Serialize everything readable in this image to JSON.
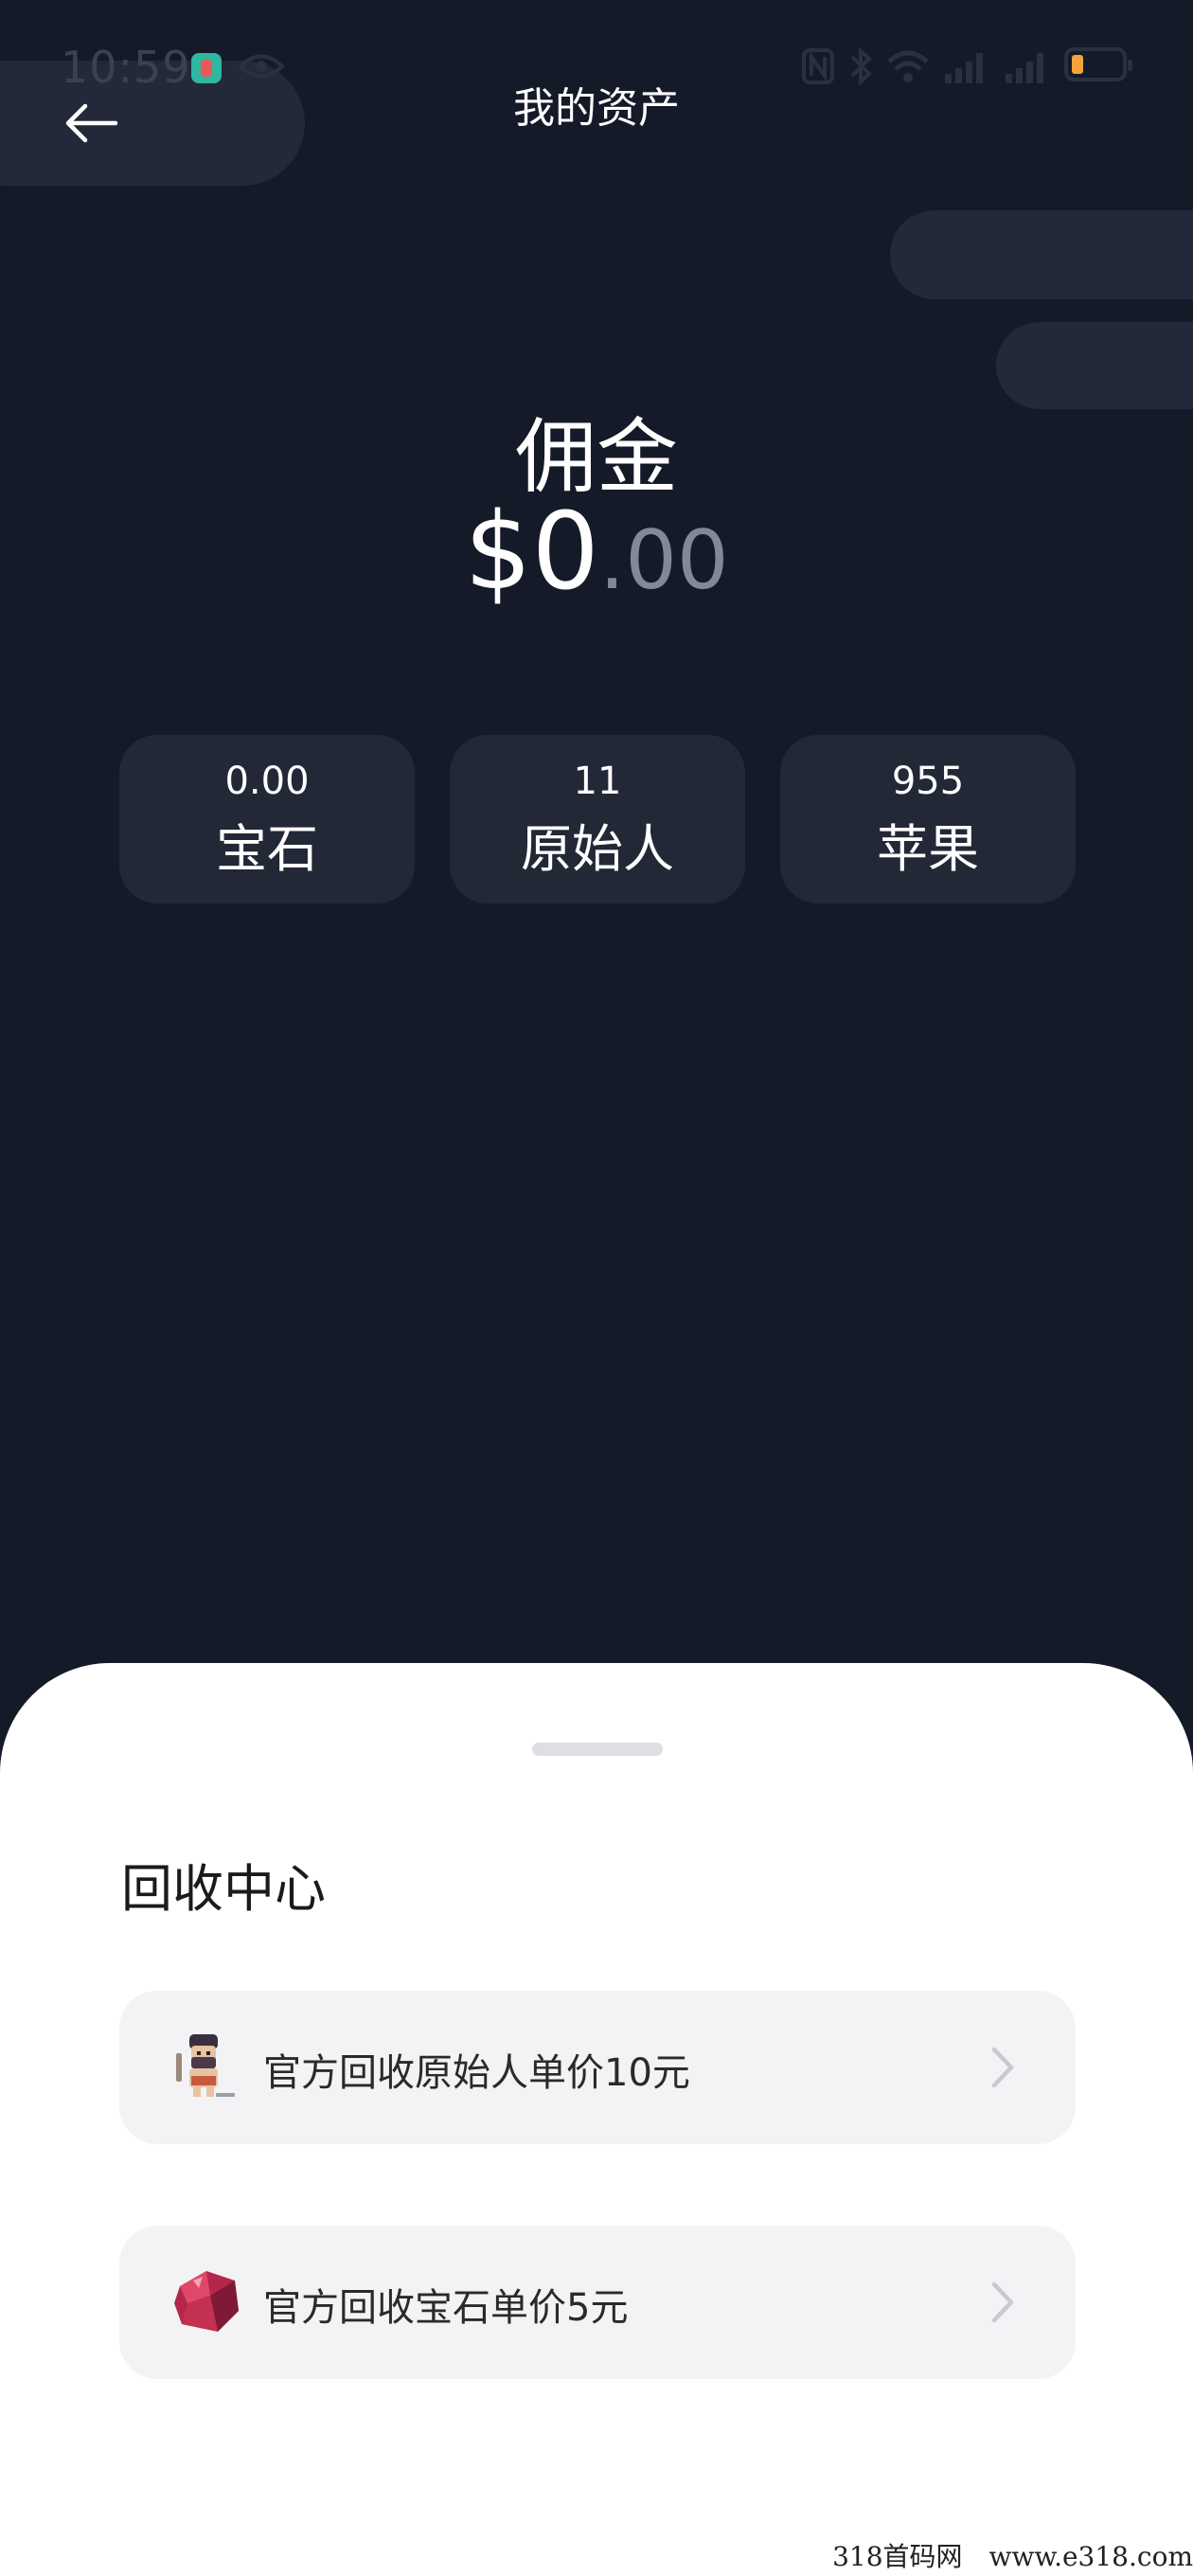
{
  "status_bar": {
    "time": "10:59"
  },
  "header": {
    "title": "我的资产",
    "back_icon": "arrow-left-icon"
  },
  "balance": {
    "label": "佣金",
    "currency": "$",
    "integer": "0",
    "decimal": ".00"
  },
  "stats": [
    {
      "value": "0.00",
      "label": "宝石"
    },
    {
      "value": "11",
      "label": "原始人"
    },
    {
      "value": "955",
      "label": "苹果"
    }
  ],
  "recycle": {
    "title": "回收中心",
    "items": [
      {
        "text": "官方回收原始人单价10元",
        "icon": "caveman-icon"
      },
      {
        "text": "官方回收宝石单价5元",
        "icon": "gem-icon"
      }
    ]
  },
  "watermark": "318首码网　www.e318.com",
  "colors": {
    "background": "#151a28",
    "card_dark": "#222836",
    "sheet": "#ffffff",
    "card_light": "#f3f3f5",
    "battery": "#f2a33a"
  }
}
